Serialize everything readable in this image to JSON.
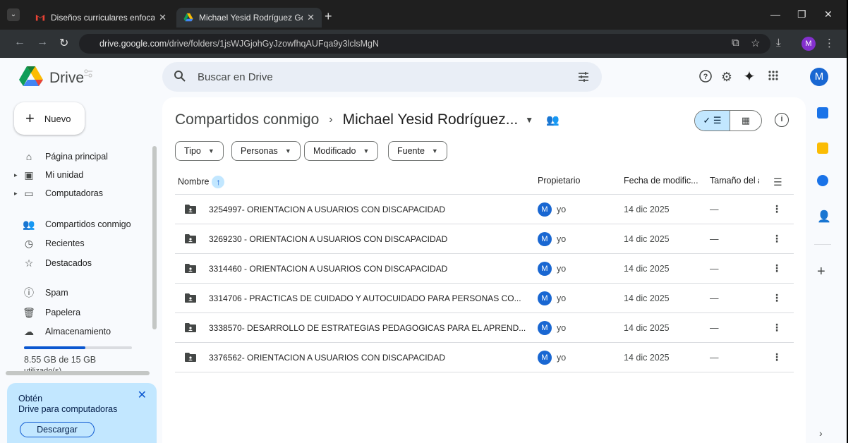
{
  "browser": {
    "tabs": [
      {
        "title": "Diseños curriculares enfocados",
        "close": "✕"
      },
      {
        "title": "Michael Yesid Rodríguez Gonzá",
        "close": "✕"
      }
    ],
    "new_tab": "+",
    "url_host": "drive.google.com",
    "url_path": "/drive/folders/1jsWJGjohGyJzowfhqAUFqa9y3lclsMgN",
    "profile_initial": "M"
  },
  "drive": {
    "brand": "Drive",
    "search_placeholder": "Buscar en Drive",
    "account_initial": "M"
  },
  "sidebar": {
    "new_label": "Nuevo",
    "items": [
      {
        "label": "Página principal",
        "icon": "home-icon"
      },
      {
        "label": "Mi unidad",
        "icon": "my-drive-icon"
      },
      {
        "label": "Computadoras",
        "icon": "computer-icon"
      },
      {
        "label": "Compartidos conmigo",
        "icon": "shared-icon"
      },
      {
        "label": "Recientes",
        "icon": "clock-icon"
      },
      {
        "label": "Destacados",
        "icon": "star-icon"
      },
      {
        "label": "Spam",
        "icon": "spam-icon"
      },
      {
        "label": "Papelera",
        "icon": "trash-icon"
      },
      {
        "label": "Almacenamiento",
        "icon": "cloud-icon"
      }
    ],
    "storage_text": "8.55 GB de 15 GB",
    "storage_fraction": 0.57,
    "storage_sub": "utilizado(s)",
    "promo": {
      "line1": "Obtén",
      "line2": "Drive para computadoras",
      "button": "Descargar",
      "close": "✕"
    }
  },
  "main": {
    "breadcrumb_root": "Compartidos conmigo",
    "breadcrumb_sep": "›",
    "breadcrumb_current": "Michael Yesid Rodríguez...",
    "filters": [
      "Tipo",
      "Personas",
      "Modificado",
      "Fuente"
    ],
    "columns": {
      "name": "Nombre",
      "owner": "Propietario",
      "modified": "Fecha de modific...",
      "size": "Tamaño del a"
    },
    "rows": [
      {
        "name": "3254997- ORIENTACION A USUARIOS CON DISCAPACIDAD",
        "owner_initial": "M",
        "owner": "yo",
        "date": "14 dic 2025",
        "size": "—"
      },
      {
        "name": "3269230 - ORIENTACION A USUARIOS CON DISCAPACIDAD",
        "owner_initial": "M",
        "owner": "yo",
        "date": "14 dic 2025",
        "size": "—"
      },
      {
        "name": "3314460 - ORIENTACION A USUARIOS CON DISCAPACIDAD",
        "owner_initial": "M",
        "owner": "yo",
        "date": "14 dic 2025",
        "size": "—"
      },
      {
        "name": "3314706 - PRACTICAS DE  CUIDADO Y AUTOCUIDADO PARA PERSONAS CO...",
        "owner_initial": "M",
        "owner": "yo",
        "date": "14 dic 2025",
        "size": "—"
      },
      {
        "name": "3338570- DESARROLLO DE ESTRATEGIAS PEDAGOGICAS PARA EL APREND...",
        "owner_initial": "M",
        "owner": "yo",
        "date": "14 dic 2025",
        "size": "—"
      },
      {
        "name": "3376562- ORIENTACION A USUARIOS CON DISCAPACIDAD",
        "owner_initial": "M",
        "owner": "yo",
        "date": "14 dic 2025",
        "size": "—"
      }
    ]
  },
  "colors": {
    "accent": "#0b57d0",
    "selected": "#c2e7ff",
    "avatar": "#1967d2"
  }
}
